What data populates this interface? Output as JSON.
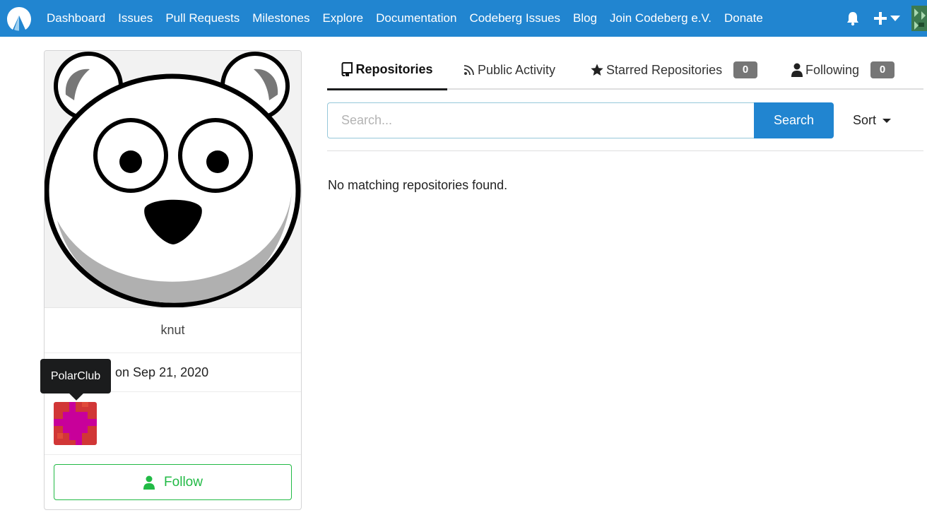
{
  "nav": {
    "items": [
      "Dashboard",
      "Issues",
      "Pull Requests",
      "Milestones",
      "Explore",
      "Documentation",
      "Codeberg Issues",
      "Blog",
      "Join Codeberg e.V.",
      "Donate"
    ]
  },
  "profile": {
    "username": "knut",
    "joined": "d on Sep 21, 2020",
    "follow_label": "Follow",
    "org_tooltip": "PolarClub"
  },
  "tabs": {
    "repositories": "Repositories",
    "activity": "Public Activity",
    "starred": "Starred Repositories",
    "starred_count": "0",
    "following": "Following",
    "following_count": "0"
  },
  "search": {
    "placeholder": "Search...",
    "button": "Search",
    "sort": "Sort"
  },
  "empty_message": "No matching repositories found.",
  "colors": {
    "primary": "#2185d0",
    "follow": "#21ba45",
    "count_badge": "#767676"
  },
  "icons": [
    "codeberg-logo-icon",
    "bell-icon",
    "plus-icon",
    "caret-down-icon",
    "repo-icon",
    "rss-icon",
    "star-icon",
    "person-icon"
  ]
}
